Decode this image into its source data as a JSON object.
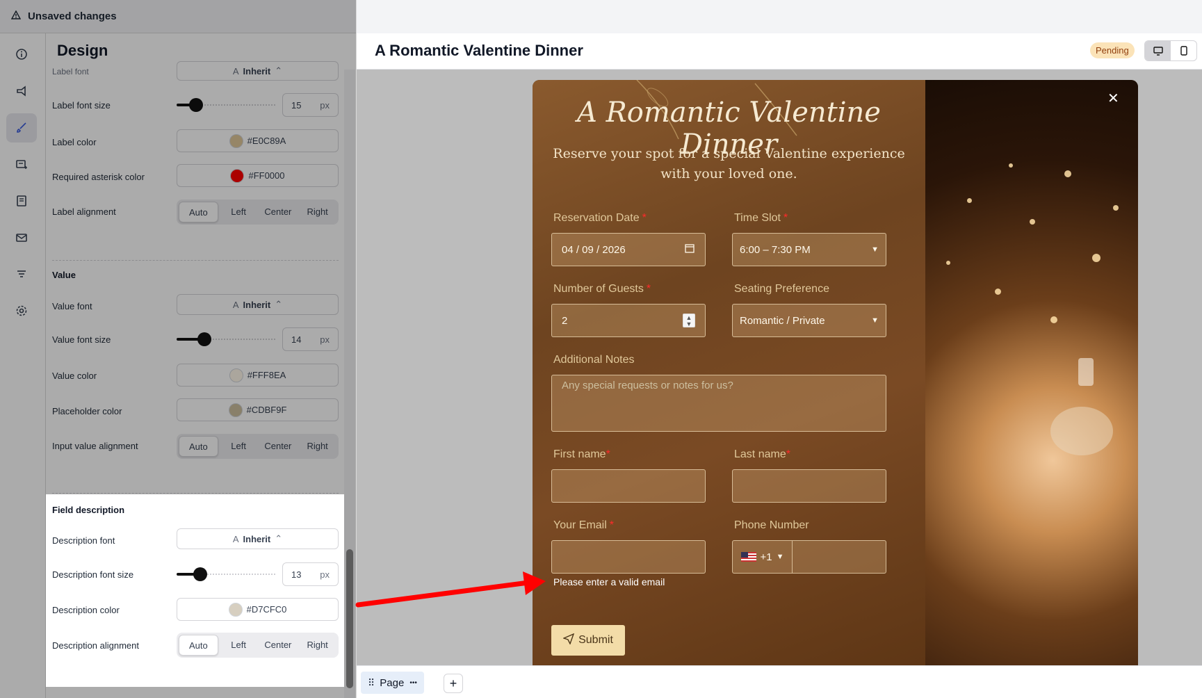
{
  "topbar": {
    "title": "Unsaved changes"
  },
  "panel": {
    "title": "Design",
    "label_section": {
      "label_font_label": "Label font",
      "label_font_value": "Inherit",
      "label_font_size_label": "Label font size",
      "label_font_size_value": "15",
      "label_font_size_level": 0.2,
      "label_color_label": "Label color",
      "label_color_value": "#E0C89A",
      "required_color_label": "Required asterisk color",
      "required_color_value": "#FF0000",
      "alignment_label": "Label alignment",
      "alignment_selected": "Auto"
    },
    "value_section": {
      "heading": "Value",
      "value_font_label": "Value font",
      "value_font_value": "Inherit",
      "value_font_size_label": "Value font size",
      "value_font_size_value": "14",
      "value_font_size_level": 0.28,
      "value_color_label": "Value color",
      "value_color_value": "#FFF8EA",
      "placeholder_color_label": "Placeholder color",
      "placeholder_color_value": "#CDBF9F",
      "alignment_label": "Input value alignment",
      "alignment_selected": "Auto"
    },
    "description_section": {
      "heading": "Field description",
      "font_label": "Description font",
      "font_value": "Inherit",
      "font_size_label": "Description font size",
      "font_size_value": "13",
      "font_size_level": 0.24,
      "color_label": "Description color",
      "color_value": "#D7CFC0",
      "alignment_label": "Description alignment",
      "alignment_selected": "Auto"
    },
    "unit": "px",
    "alignment_options": [
      "Auto",
      "Left",
      "Center",
      "Right"
    ]
  },
  "rail": {
    "icons": [
      "info-icon",
      "megaphone-icon",
      "brush-icon",
      "form-icon",
      "notes-icon",
      "mail-icon",
      "filter-icon",
      "gear-icon"
    ],
    "active": "brush-icon"
  },
  "header": {
    "title": "A Romantic Valentine Dinner",
    "status": "Pending"
  },
  "form": {
    "heading": "A Romantic Valentine Dinner",
    "subheading": "Reserve your spot for a special Valentine experience with your loved one.",
    "reservation_date_label": "Reservation Date",
    "reservation_date_value": "04 / 09 / 2026",
    "time_slot_label": "Time Slot",
    "time_slot_value": "6:00 – 7:30 PM",
    "guests_label": "Number of Guests",
    "guests_value": "2",
    "seating_label": "Seating Preference",
    "seating_value": "Romantic / Private",
    "notes_label": "Additional Notes",
    "notes_placeholder": "Any special requests or notes for us?",
    "first_name_label": "First name",
    "last_name_label": "Last name",
    "email_label": "Your Email",
    "phone_label": "Phone Number",
    "phone_code": "+1",
    "email_description": "Please enter a valid email",
    "submit_label": "Submit"
  },
  "pagebar": {
    "page_label": "Page",
    "more": "•••",
    "add": "+"
  },
  "colors": {
    "accent": "#3b5bdb",
    "arrow": "#ff0000",
    "pending_bg": "#fbe3b8"
  }
}
